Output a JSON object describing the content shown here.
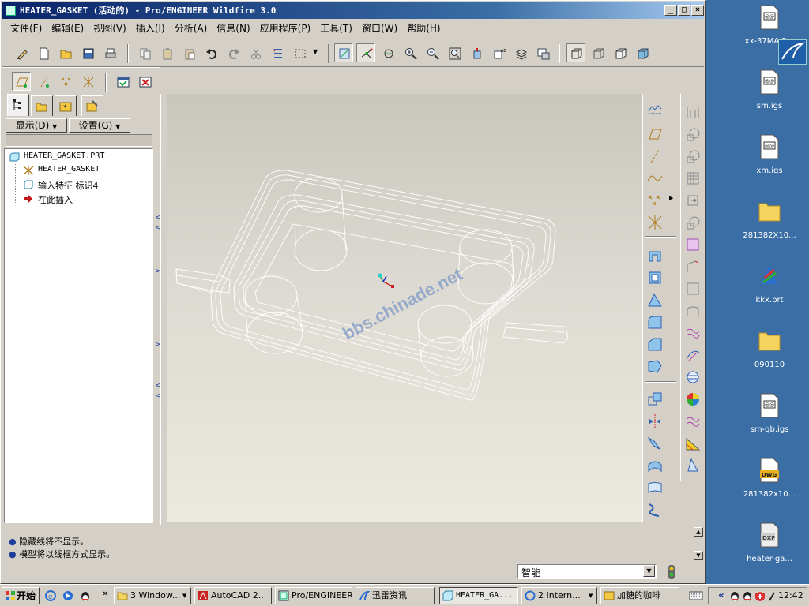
{
  "window": {
    "title": "HEATER_GASKET (活动的) - Pro/ENGINEER Wildfire 3.0",
    "controls": [
      "_",
      "□",
      "×"
    ]
  },
  "menu": [
    "文件(F)",
    "编辑(E)",
    "视图(V)",
    "插入(I)",
    "分析(A)",
    "信息(N)",
    "应用程序(P)",
    "工具(T)",
    "窗口(W)",
    "帮助(H)"
  ],
  "panel": {
    "show_label": "显示(D)",
    "settings_label": "设置(G)",
    "tree": [
      {
        "label": "HEATER_GASKET.PRT",
        "icon": "part-icon"
      },
      {
        "label": "HEATER_GASKET",
        "icon": "csys-icon"
      },
      {
        "label": "输入特征 标识4",
        "icon": "import-feature-icon"
      },
      {
        "label": "在此插入",
        "icon": "insert-here-arrow-icon"
      }
    ]
  },
  "viewport": {
    "watermark": "bbs.chinade.net"
  },
  "messages": [
    "隐藏线将不显示。",
    "模型将以线框方式显示。"
  ],
  "status": {
    "filter_value": "智能"
  },
  "taskbar": {
    "start_label": "开始",
    "tasks": [
      "3 Window...",
      "AutoCAD 2...",
      "Pro/ENGINEER",
      "迅雷资讯",
      "HEATER_GA...",
      "2 Intern...",
      "加糖的咖啡"
    ],
    "clock": "12:42"
  },
  "desktop": {
    "icons": [
      {
        "label": "xx-37MA-2...",
        "icon": "igs-file-icon"
      },
      {
        "label": "sm.igs",
        "icon": "igs-file-icon"
      },
      {
        "label": "xm.igs",
        "icon": "igs-file-icon"
      },
      {
        "label": "281382X10...",
        "icon": "folder-icon"
      },
      {
        "label": "kkx.prt",
        "icon": "prt-file-icon"
      },
      {
        "label": "090110",
        "icon": "folder-icon"
      },
      {
        "label": "sm-qb.igs",
        "icon": "igs-file-icon"
      },
      {
        "label": "281382x10...",
        "icon": "dwg-file-icon"
      },
      {
        "label": "heater-ga...",
        "icon": "dxf-file-icon"
      }
    ]
  },
  "colors": {
    "titlebar": "#0a246a",
    "desktop": "#3a6ea5",
    "chrome": "#d4d0c8",
    "wireframe": "#ffffff"
  }
}
